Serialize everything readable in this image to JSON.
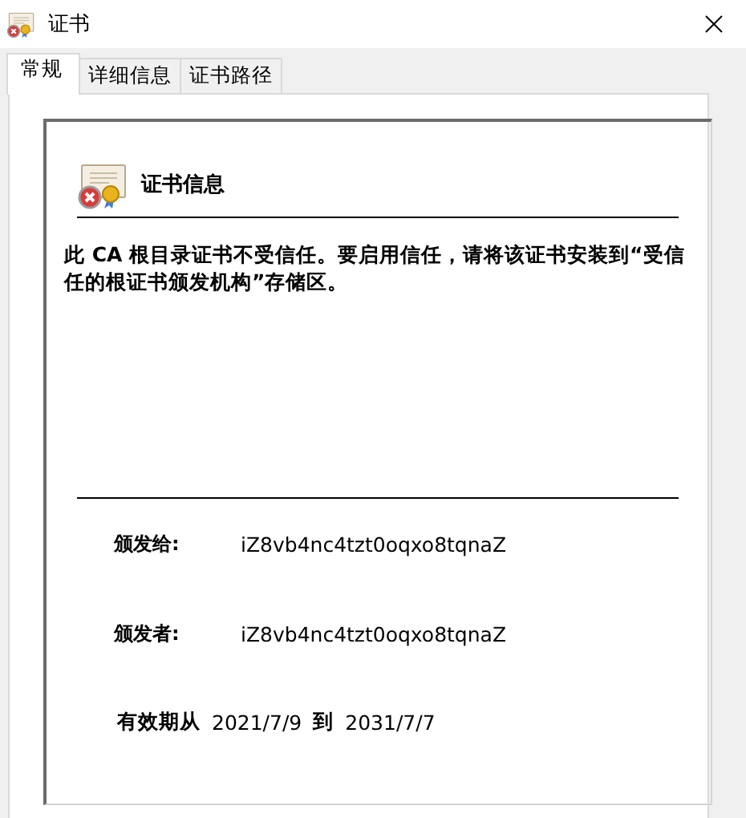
{
  "window": {
    "title": "证书"
  },
  "tabs": [
    {
      "label": "常规",
      "selected": true
    },
    {
      "label": "详细信息",
      "selected": false
    },
    {
      "label": "证书路径",
      "selected": false
    }
  ],
  "cert_info": {
    "heading": "证书信息",
    "warning": "此 CA 根目录证书不受信任。要启用信任，请将该证书安装到“受信任的根证书颁发机构”存储区。",
    "fields": [
      {
        "label": "颁发给:",
        "value": "iZ8vb4nc4tzt0oqxo8tqnaZ"
      },
      {
        "label": "颁发者:",
        "value": "iZ8vb4nc4tzt0oqxo8tqnaZ"
      }
    ],
    "validity": {
      "label": "有效期从",
      "from": "2021/7/9",
      "to_label": "到",
      "to": "2031/7/7"
    }
  }
}
